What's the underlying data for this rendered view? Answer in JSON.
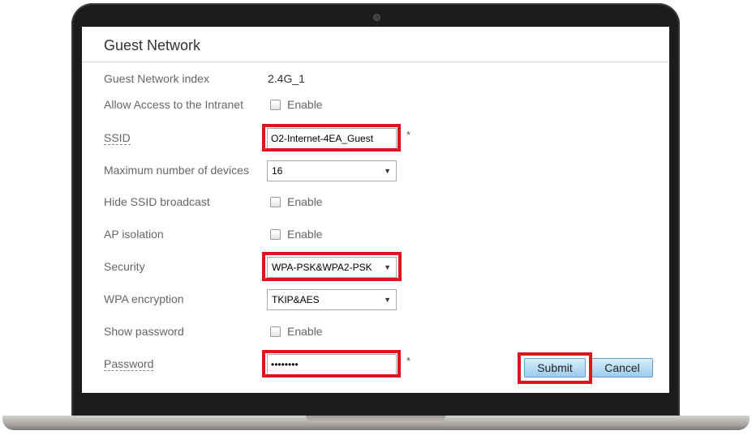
{
  "page": {
    "title": "Guest Network"
  },
  "form": {
    "index_label": "Guest Network index",
    "index_value": "2.4G_1",
    "intranet_label": "Allow Access to the Intranet",
    "intranet_checkbox_label": "Enable",
    "ssid_label": "SSID",
    "ssid_value": "O2-Internet-4EA_Guest",
    "ssid_required": "*",
    "max_devices_label": "Maximum number of devices",
    "max_devices_value": "16",
    "hide_ssid_label": "Hide SSID broadcast",
    "hide_ssid_checkbox_label": "Enable",
    "ap_isolation_label": "AP isolation",
    "ap_isolation_checkbox_label": "Enable",
    "security_label": "Security",
    "security_value": "WPA-PSK&WPA2-PSK",
    "wpa_encryption_label": "WPA encryption",
    "wpa_encryption_value": "TKIP&AES",
    "show_password_label": "Show password",
    "show_password_checkbox_label": "Enable",
    "password_label": "Password",
    "password_value": "••••••••",
    "password_required": "*"
  },
  "buttons": {
    "submit_label": "Submit",
    "cancel_label": "Cancel"
  },
  "icons": {
    "select_arrow": "▼"
  },
  "colors": {
    "highlight": "#e0141e",
    "button_top": "#d8eefc",
    "button_bottom": "#9ccbec"
  }
}
